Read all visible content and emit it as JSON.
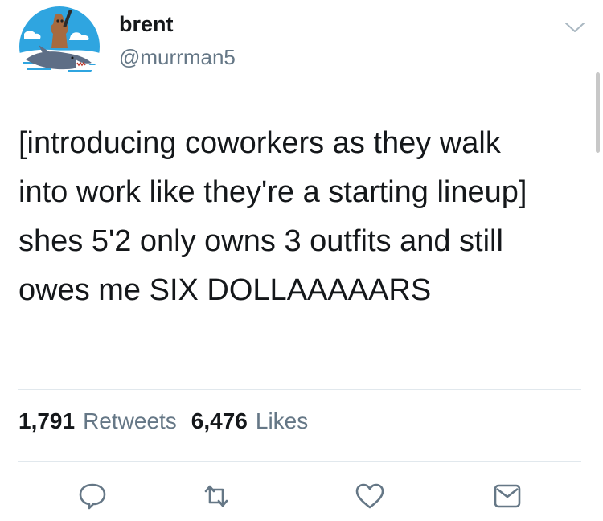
{
  "author": {
    "name": "brent",
    "handle": "@murrman5"
  },
  "tweet": {
    "text": "[introducing coworkers as they walk\ninto work like they're a starting lineup]\nshes 5'2 only owns 3 outfits and still\nowes me SIX DOLLAAAAARS"
  },
  "stats": {
    "retweets_count": "1,791",
    "retweets_label": "Retweets",
    "likes_count": "6,476",
    "likes_label": "Likes"
  },
  "actions": [
    "reply-icon",
    "retweet-icon",
    "like-icon",
    "message-icon"
  ],
  "colors": {
    "text": "#14171a",
    "secondary": "#657786",
    "divider": "#e1e8ed",
    "avatar_sky": "#2fa5e0",
    "shark": "#5e6e86"
  }
}
